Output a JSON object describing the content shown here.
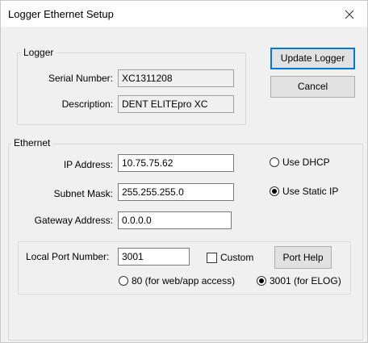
{
  "window": {
    "title": "Logger Ethernet Setup"
  },
  "logger": {
    "legend": "Logger",
    "serial_label": "Serial Number:",
    "serial_value": "XC1311208",
    "description_label": "Description:",
    "description_value": "DENT ELITEpro XC"
  },
  "buttons": {
    "update": "Update Logger",
    "cancel": "Cancel",
    "port_help": "Port Help"
  },
  "ethernet": {
    "legend": "Ethernet",
    "ip_label": "IP Address:",
    "ip_value": "10.75.75.62",
    "subnet_label": "Subnet Mask:",
    "subnet_value": "255.255.255.0",
    "gateway_label": "Gateway Address:",
    "gateway_value": "0.0.0.0",
    "use_dhcp": {
      "label": "Use DHCP",
      "selected": false
    },
    "use_static": {
      "label": "Use Static IP",
      "selected": true
    }
  },
  "port": {
    "label": "Local Port Number:",
    "value": "3001",
    "custom_label": "Custom",
    "custom_checked": false,
    "opt_80": {
      "label": "80 (for web/app access)",
      "selected": false
    },
    "opt_3001": {
      "label": "3001 (for ELOG)",
      "selected": true
    }
  }
}
